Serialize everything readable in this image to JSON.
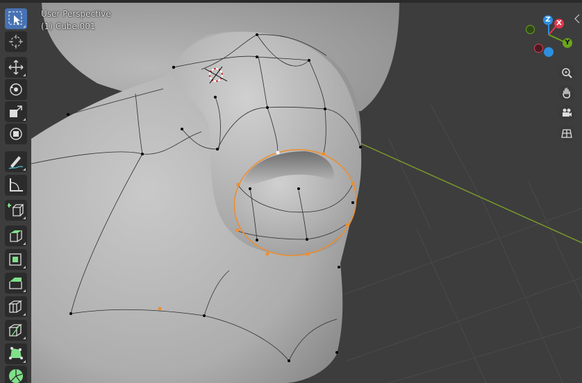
{
  "viewport": {
    "view_name": "User Perspective",
    "object_name": "(1) Cube.001"
  },
  "gizmo": {
    "axes": [
      {
        "name": "Z",
        "color": "#2e8ee0"
      },
      {
        "name": "X",
        "color": "#e0394f"
      },
      {
        "name": "Y",
        "color": "#6ba51c"
      }
    ]
  },
  "toolbar": {
    "tools": [
      {
        "name": "select-box",
        "active": true
      },
      {
        "name": "cursor",
        "active": false
      },
      {
        "name": "move",
        "active": false
      },
      {
        "name": "rotate",
        "active": false
      },
      {
        "name": "scale",
        "active": false
      },
      {
        "name": "transform",
        "active": false
      },
      {
        "name": "annotate",
        "active": false
      },
      {
        "name": "measure",
        "active": false
      },
      {
        "name": "add-cube",
        "active": false
      },
      {
        "name": "extrude-region",
        "active": false
      },
      {
        "name": "inset-faces",
        "active": false
      },
      {
        "name": "bevel",
        "active": false
      },
      {
        "name": "loop-cut",
        "active": false
      },
      {
        "name": "knife",
        "active": false
      },
      {
        "name": "poly-build",
        "active": false
      },
      {
        "name": "spin",
        "active": false
      }
    ]
  },
  "navigation": [
    "zoom-icon",
    "hand-pan-icon",
    "camera-icon",
    "grid-icon"
  ],
  "colors": {
    "background": "#3d3d3d",
    "mesh": "#b5b5b5",
    "selected": "#f08c2a",
    "x_axis_line": "#7a9b2a",
    "active_tool": "#4772b3"
  }
}
